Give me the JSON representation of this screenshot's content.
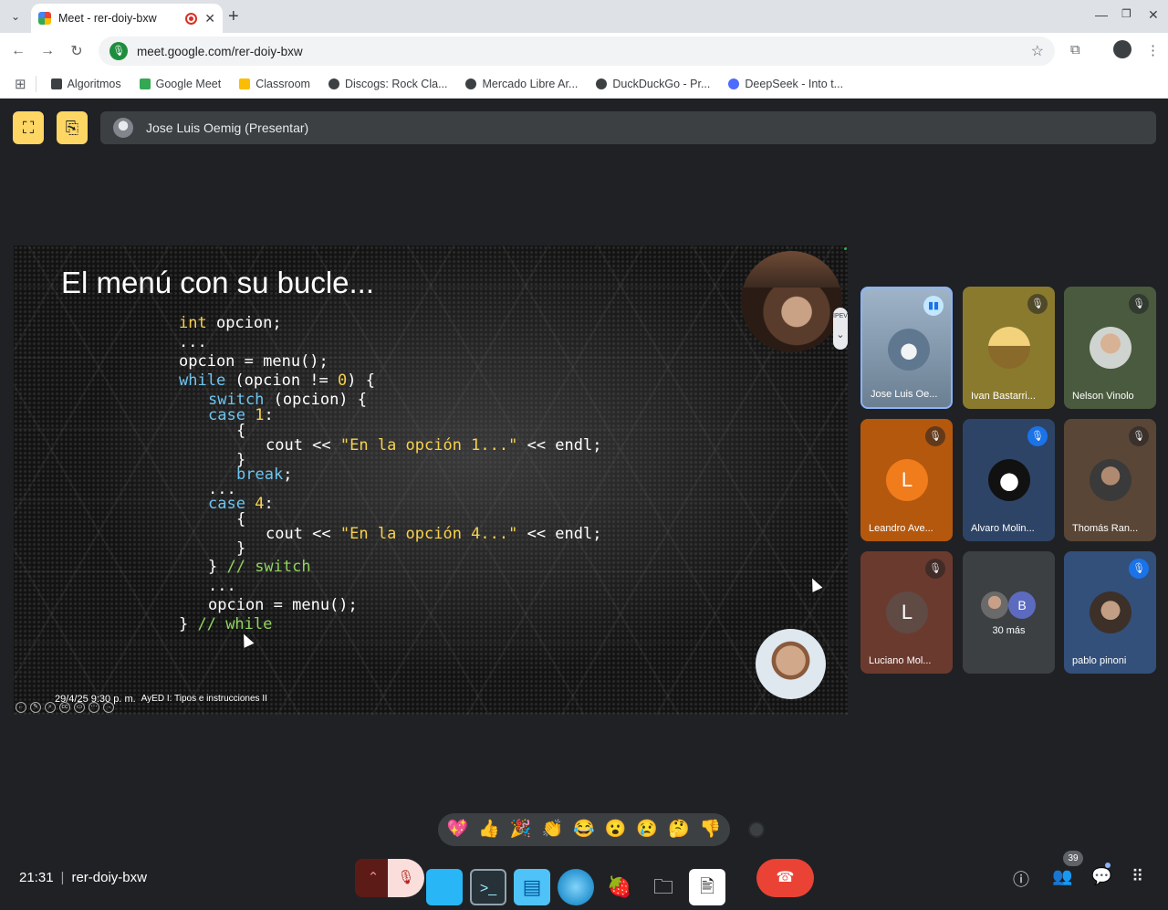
{
  "browser": {
    "tab_title": "Meet - rer-doiy-bxw",
    "url": "meet.google.com/rer-doiy-bxw",
    "bookmarks": [
      {
        "label": "Algoritmos",
        "color": "#3c4043"
      },
      {
        "label": "Google Meet",
        "color": "#34a853"
      },
      {
        "label": "Classroom",
        "color": "#fbbc04"
      },
      {
        "label": "Discogs: Rock Cla...",
        "color": "#3c4043"
      },
      {
        "label": "Mercado Libre Ar...",
        "color": "#3c4043"
      },
      {
        "label": "DuckDuckGo - Pr...",
        "color": "#3c4043"
      },
      {
        "label": "DeepSeek - Into t...",
        "color": "#4d6bfe"
      }
    ]
  },
  "meeting": {
    "presenter_label": "Jose Luis Oemig (Presentar)",
    "time": "21:31",
    "code": "rer-doiy-bxw",
    "participant_count": "39",
    "more_label": "30 más"
  },
  "slide": {
    "title": "El menú con su bucle...",
    "footer_date": "29/4/25 9:30 p. m.",
    "footer_subject": "AyED I: Tipos e instrucciones II"
  },
  "participants": [
    {
      "name": "Jose Luis Oe...",
      "mic": "speaking",
      "bg": "#8aa2b8"
    },
    {
      "name": "Ivan Bastarri...",
      "mic": "muted",
      "bg": "#8a7a2e"
    },
    {
      "name": "Nelson Vinolo",
      "mic": "muted",
      "bg": "#4a5a3e"
    },
    {
      "name": "Leandro Ave...",
      "mic": "muted",
      "bg": "#b4580e",
      "letter": "L",
      "letter_bg": "#f07c1c"
    },
    {
      "name": "Alvaro Molin...",
      "mic": "muted",
      "bg": "#2e4466"
    },
    {
      "name": "Thomás Ran...",
      "mic": "muted",
      "bg": "#5a4636"
    },
    {
      "name": "Luciano Mol...",
      "mic": "muted",
      "bg": "#6b3a2e",
      "letter": "L",
      "letter_bg": "#5f4a44"
    },
    {
      "name": "pablo pinoni",
      "mic": "muted",
      "bg": "#33507a"
    }
  ],
  "reactions": [
    "💖",
    "👍",
    "🎉",
    "👏",
    "😂",
    "😮",
    "😢",
    "🤔",
    "👎"
  ],
  "colors": {
    "accent_yellow": "#fdd663",
    "leave_red": "#ea4335",
    "active_blue": "#8ab4f8"
  }
}
